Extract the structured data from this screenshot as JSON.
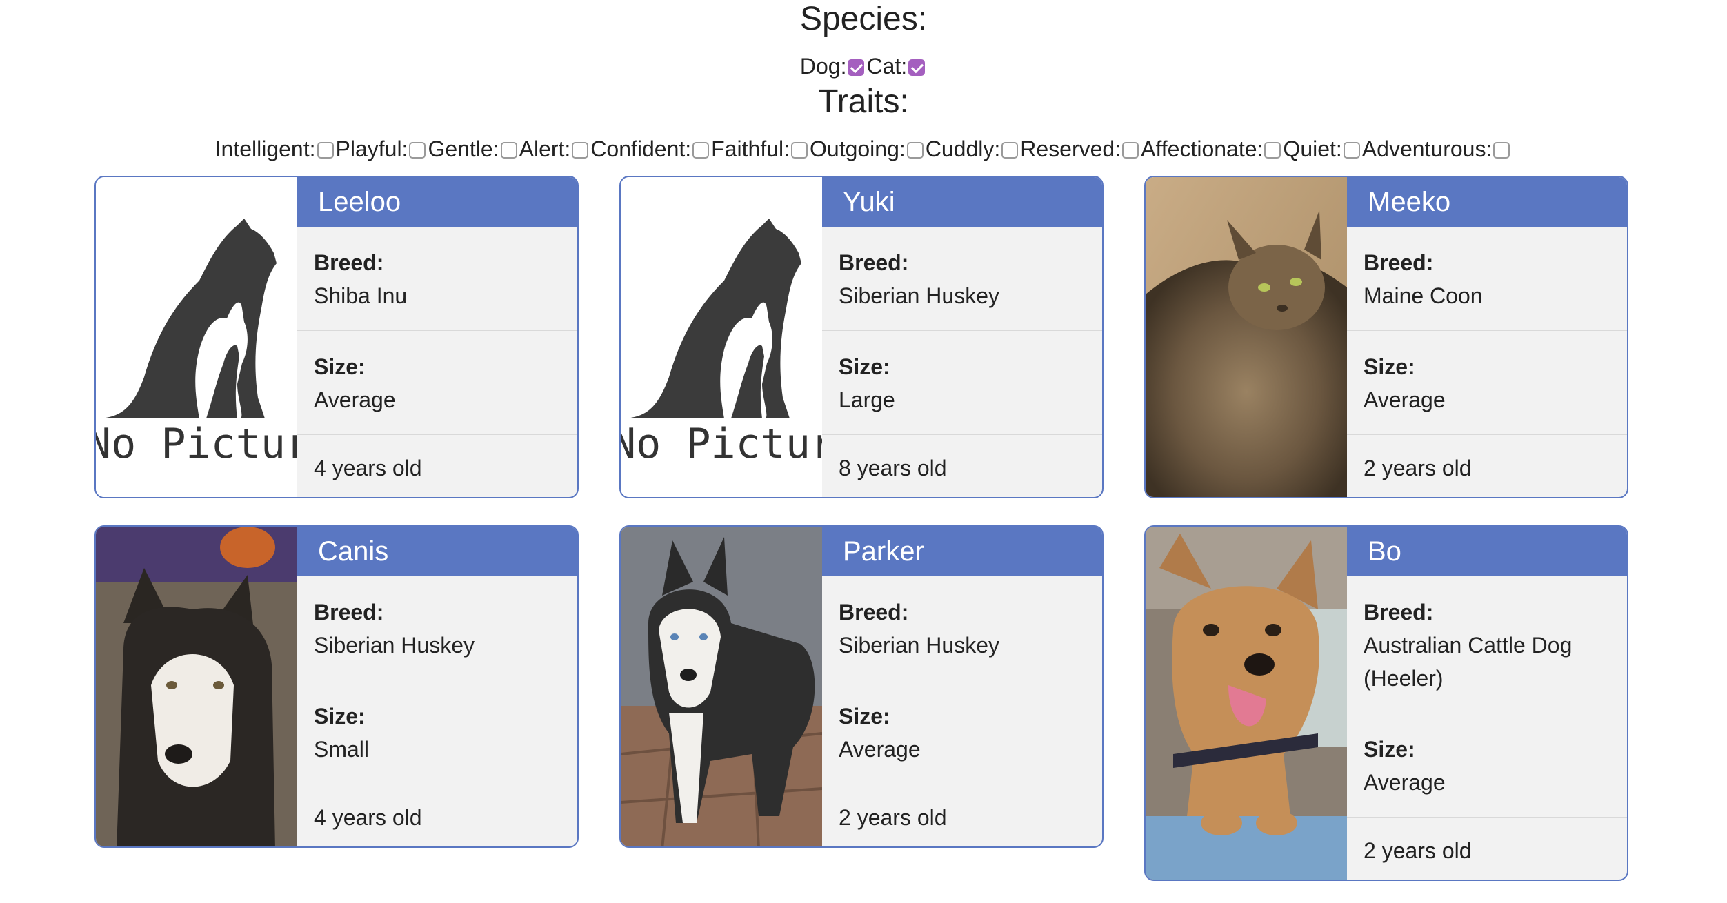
{
  "filters": {
    "species_heading": "Species:",
    "species": [
      {
        "label": "Dog:",
        "checked": true
      },
      {
        "label": "Cat:",
        "checked": true
      }
    ],
    "traits_heading": "Traits:",
    "traits": [
      {
        "label": "Intelligent:",
        "checked": false
      },
      {
        "label": "Playful:",
        "checked": false
      },
      {
        "label": "Gentle:",
        "checked": false
      },
      {
        "label": "Alert:",
        "checked": false
      },
      {
        "label": "Confident:",
        "checked": false
      },
      {
        "label": "Faithful:",
        "checked": false
      },
      {
        "label": "Outgoing:",
        "checked": false
      },
      {
        "label": "Cuddly:",
        "checked": false
      },
      {
        "label": "Reserved:",
        "checked": false
      },
      {
        "label": "Affectionate:",
        "checked": false
      },
      {
        "label": "Quiet:",
        "checked": false
      },
      {
        "label": "Adventurous:",
        "checked": false
      }
    ]
  },
  "labels": {
    "breed": "Breed:",
    "size": "Size:"
  },
  "pets": [
    {
      "name": "Leeloo",
      "breed": "Shiba Inu",
      "size": "Average",
      "age": "4 years old",
      "photo": "no-picture",
      "no_picture_text": "No Picture"
    },
    {
      "name": "Yuki",
      "breed": "Siberian Huskey",
      "size": "Large",
      "age": "8 years old",
      "photo": "no-picture",
      "no_picture_text": "No Picture"
    },
    {
      "name": "Meeko",
      "breed": "Maine Coon",
      "size": "Average",
      "age": "2 years old",
      "photo": "cat-photo"
    },
    {
      "name": "Canis",
      "breed": "Siberian Huskey",
      "size": "Small",
      "age": "4 years old",
      "photo": "husky-photo"
    },
    {
      "name": "Parker",
      "breed": "Siberian Huskey",
      "size": "Average",
      "age": "2 years old",
      "photo": "husky-photo"
    },
    {
      "name": "Bo",
      "breed": "Australian Cattle Dog (Heeler)",
      "size": "Average",
      "age": "2 years old",
      "photo": "dog-photo"
    }
  ],
  "colors": {
    "accent": "#5a77c2",
    "checkbox_checked": "#a45fbf",
    "card_bg": "#f2f2f2"
  }
}
